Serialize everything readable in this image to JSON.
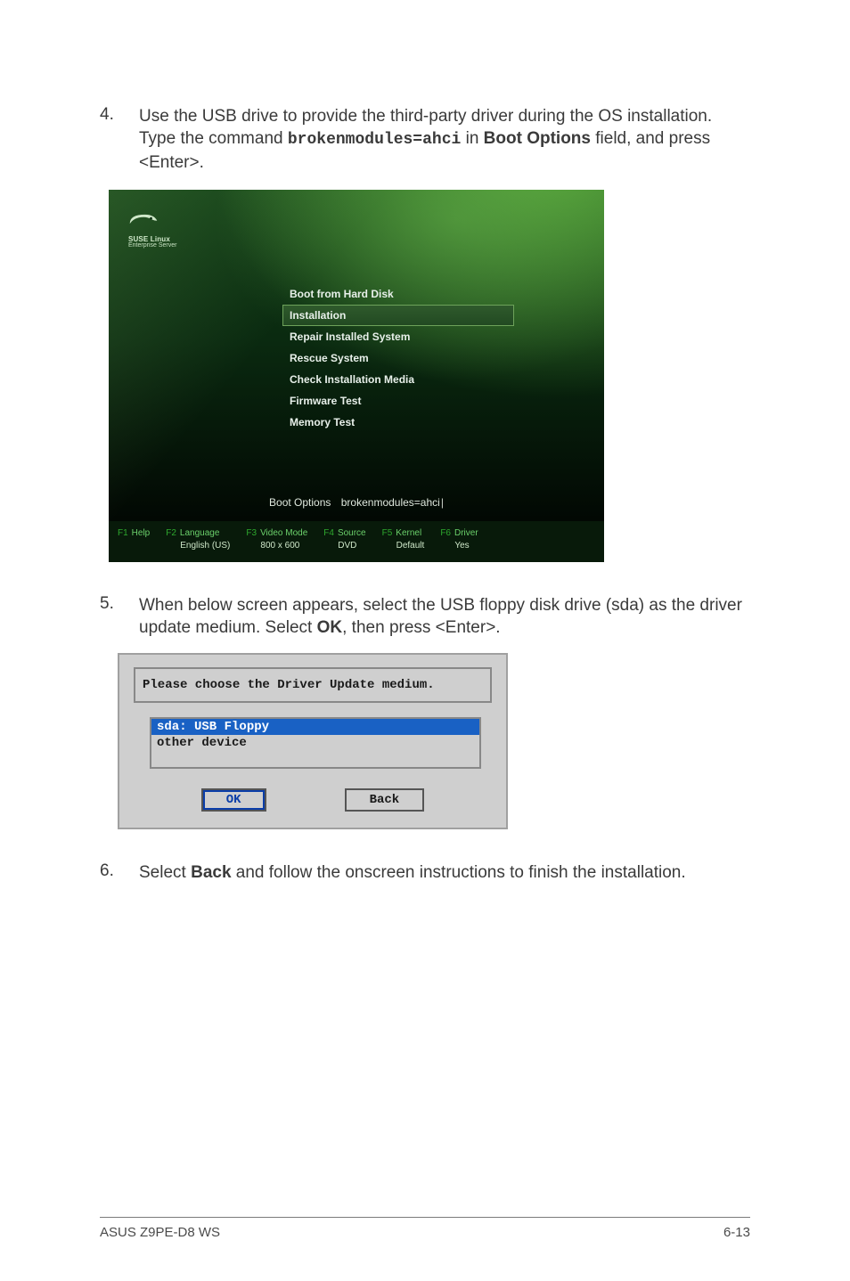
{
  "steps": {
    "s4": {
      "num": "4.",
      "text_pre": "Use the USB drive to provide the third-party driver during the OS installation. Type the command ",
      "code": "brokenmodules=ahci",
      "text_mid": " in ",
      "bold1": "Boot Options",
      "text_post": " field, and press <Enter>."
    },
    "s5": {
      "num": "5.",
      "text_pre": "When below screen appears, select the USB floppy disk drive (sda) as the driver update medium. Select ",
      "bold1": "OK",
      "text_post": ", then press <Enter>."
    },
    "s6": {
      "num": "6.",
      "text_pre": "Select ",
      "bold1": "Back",
      "text_post": " and follow the onscreen instructions to finish the installation."
    }
  },
  "suse": {
    "brand1": "SUSE Linux",
    "brand2": "Enterprise Server",
    "menu": [
      "Boot from Hard Disk",
      "Installation",
      "Repair Installed System",
      "Rescue System",
      "Check Installation Media",
      "Firmware Test",
      "Memory Test"
    ],
    "boot_label": "Boot Options",
    "boot_value": "brokenmodules=ahci",
    "f1": {
      "key": "F1",
      "label": "Help",
      "value": ""
    },
    "f2": {
      "key": "F2",
      "label": "Language",
      "value": "English (US)"
    },
    "f3": {
      "key": "F3",
      "label": "Video Mode",
      "value": "800 x 600"
    },
    "f4": {
      "key": "F4",
      "label": "Source",
      "value": "DVD"
    },
    "f5": {
      "key": "F5",
      "label": "Kernel",
      "value": "Default"
    },
    "f6": {
      "key": "F6",
      "label": "Driver",
      "value": "Yes"
    }
  },
  "dialog": {
    "title": "Please choose the Driver Update medium.",
    "options": [
      "sda: USB Floppy",
      "other device"
    ],
    "ok": "OK",
    "back": "Back"
  },
  "footer": {
    "left": "ASUS Z9PE-D8 WS",
    "right": "6-13"
  }
}
